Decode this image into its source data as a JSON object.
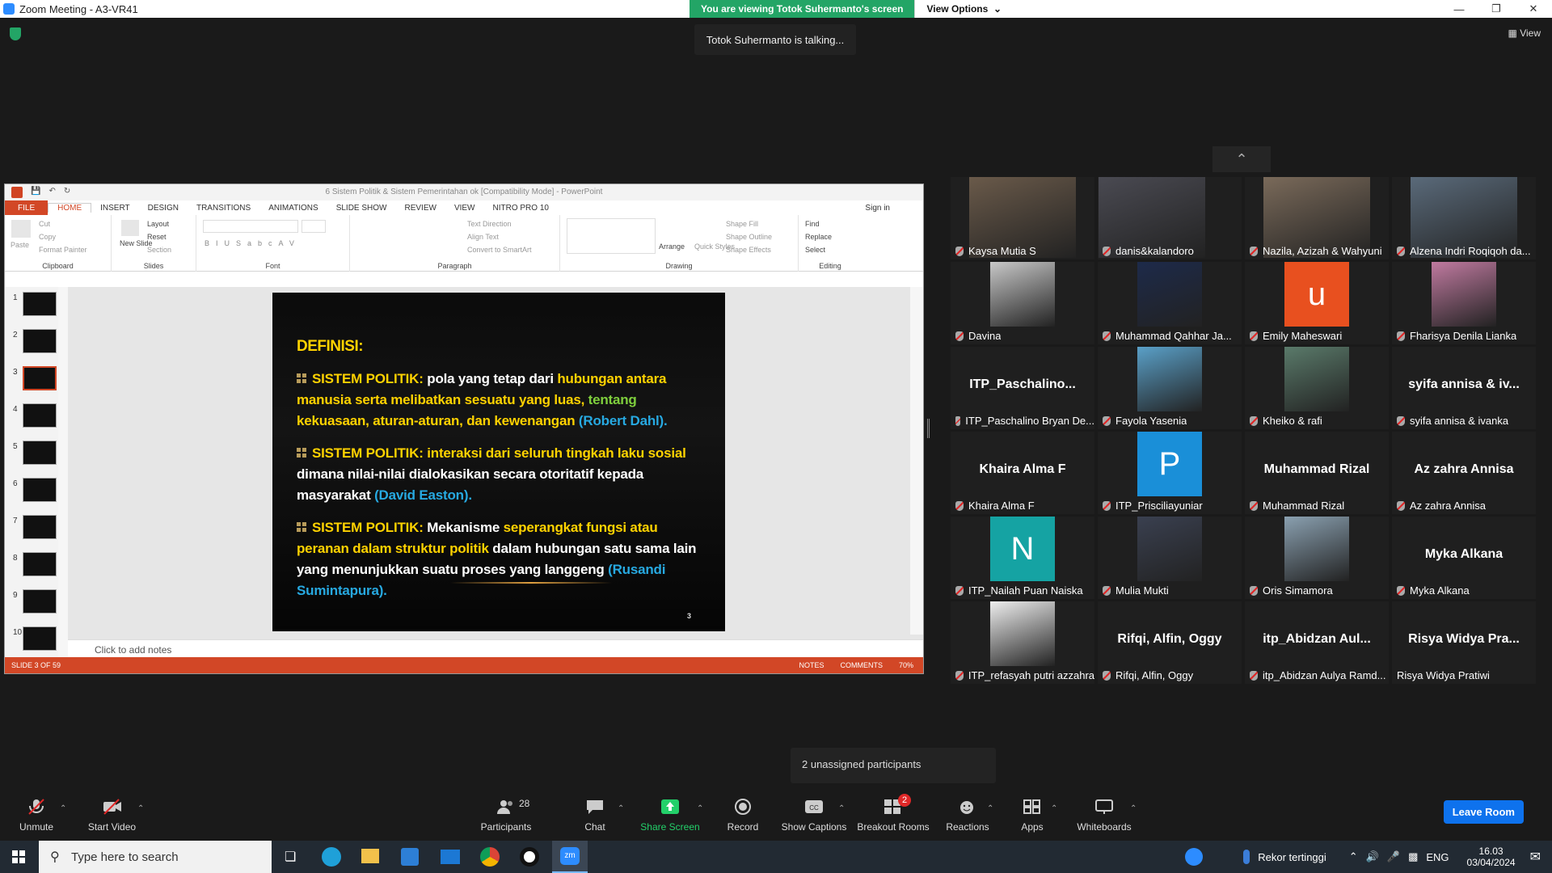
{
  "window": {
    "title": "Zoom Meeting - A3-VR41"
  },
  "banner": {
    "viewing": "You are viewing Totok Suhermanto's screen",
    "view_options": "View Options"
  },
  "talking": "Totok Suhermanto is talking...",
  "top_view_label": "View",
  "ppt": {
    "title": "6 Sistem Politik & Sistem Pemerintahan ok [Compatibility Mode] - PowerPoint",
    "tabs": [
      "FILE",
      "HOME",
      "INSERT",
      "DESIGN",
      "TRANSITIONS",
      "ANIMATIONS",
      "SLIDE SHOW",
      "REVIEW",
      "VIEW",
      "NITRO PRO 10"
    ],
    "sign_in": "Sign in",
    "ribbon": {
      "clipboard": {
        "paste": "Paste",
        "cut": "Cut",
        "copy": "Copy",
        "format_painter": "Format Painter",
        "label": "Clipboard"
      },
      "slides": {
        "new_slide": "New Slide",
        "layout": "Layout",
        "reset": "Reset",
        "section": "Section",
        "label": "Slides"
      },
      "font": {
        "label": "Font"
      },
      "paragraph": {
        "text_direction": "Text Direction",
        "align_text": "Align Text",
        "convert": "Convert to SmartArt",
        "label": "Paragraph"
      },
      "drawing": {
        "arrange": "Arrange",
        "quick_styles": "Quick Styles",
        "shape_fill": "Shape Fill",
        "shape_outline": "Shape Outline",
        "shape_effects": "Shape Effects",
        "label": "Drawing"
      },
      "editing": {
        "find": "Find",
        "replace": "Replace",
        "select": "Select",
        "label": "Editing"
      }
    },
    "thumb_numbers": [
      "1",
      "2",
      "3",
      "4",
      "5",
      "6",
      "7",
      "8",
      "9",
      "10"
    ],
    "slide": {
      "heading": "DEFINISI:",
      "p1": {
        "a": "SISTEM POLITIK:",
        "b": " pola yang tetap dari ",
        "c": "hubungan antara manusia serta melibatkan sesuatu yang luas,",
        "d": " tentang",
        "e": " kekuasaan, aturan-aturan, dan kewenangan",
        "f": " (Robert Dahl)."
      },
      "p2": {
        "a": "SISTEM POLITIK:",
        "b": " interaksi dari seluruh tingkah laku sosial",
        "c": " dimana nilai-nilai dialokasikan secara otoritatif kepada masyarakat",
        "d": " (David Easton)."
      },
      "p3": {
        "a": "SISTEM POLITIK:",
        "b": " Mekanisme ",
        "c": "seperangkat fungsi atau peranan dalam struktur politik",
        "d": " dalam hubungan satu sama lain yang menunjukkan suatu proses yang langgeng",
        "e": " (Rusandi Sumintapura)."
      },
      "page_number": "3"
    },
    "notes_placeholder": "Click to add notes",
    "status": {
      "slide": "SLIDE 3 OF 59",
      "notes": "NOTES",
      "comments": "COMMENTS",
      "zoom": "70%"
    }
  },
  "participants": [
    {
      "name": "Kaysa Mutia S",
      "kind": "video"
    },
    {
      "name": "danis&kalandoro",
      "kind": "video"
    },
    {
      "name": "Nazila, Azizah & Wahyuni",
      "kind": "video"
    },
    {
      "name": "Alzena Indri Roqiqoh da...",
      "kind": "video"
    },
    {
      "name": "Davina",
      "kind": "photo"
    },
    {
      "name": "Muhammad Qahhar Ja...",
      "kind": "photo"
    },
    {
      "name": "Emily Maheswari",
      "kind": "letter",
      "letter": "u",
      "color": "#e8501f"
    },
    {
      "name": "Fharisya Denila Lianka",
      "kind": "photo"
    },
    {
      "name": "ITP_Paschalino Bryan De...",
      "kind": "text",
      "big": "ITP_Paschalino..."
    },
    {
      "name": "Fayola Yasenia",
      "kind": "photo"
    },
    {
      "name": "Kheiko & rafi",
      "kind": "photo"
    },
    {
      "name": "syifa annisa & ivanka",
      "kind": "text",
      "big": "syifa annisa & iv..."
    },
    {
      "name": "Khaira Alma F",
      "kind": "text",
      "big": "Khaira Alma F"
    },
    {
      "name": "ITP_Prisciliayuniar",
      "kind": "letter",
      "letter": "P",
      "color": "#1a8fd8"
    },
    {
      "name": "Muhammad Rizal",
      "kind": "text",
      "big": "Muhammad Rizal"
    },
    {
      "name": "Az zahra Annisa",
      "kind": "text",
      "big": "Az zahra Annisa"
    },
    {
      "name": "ITP_Nailah Puan Naiska",
      "kind": "letter",
      "letter": "N",
      "color": "#15a3a3"
    },
    {
      "name": "Mulia Mukti",
      "kind": "photo"
    },
    {
      "name": "Oris Simamora",
      "kind": "photo"
    },
    {
      "name": "Myka Alkana",
      "kind": "text",
      "big": "Myka Alkana"
    },
    {
      "name": "ITP_refasyah putri azzahra",
      "kind": "photo"
    },
    {
      "name": "Rifqi, Alfin, Oggy",
      "kind": "text",
      "big": "Rifqi, Alfin, Oggy"
    },
    {
      "name": "itp_Abidzan Aulya Ramd...",
      "kind": "text",
      "big": "itp_Abidzan  Aul..."
    },
    {
      "name": "Risya Widya Pratiwi",
      "kind": "text",
      "big": "Risya  Widya  Pra...",
      "unmuted": true
    }
  ],
  "unassigned": "2 unassigned participants",
  "toolbar": {
    "unmute": "Unmute",
    "start_video": "Start Video",
    "participants": "Participants",
    "participants_count": "28",
    "chat": "Chat",
    "share_screen": "Share Screen",
    "record": "Record",
    "show_captions": "Show Captions",
    "breakout_rooms": "Breakout Rooms",
    "breakout_badge": "2",
    "reactions": "Reactions",
    "apps": "Apps",
    "whiteboards": "Whiteboards",
    "leave": "Leave Room"
  },
  "taskbar": {
    "search_placeholder": "Type here to search",
    "news": "Rekor tertinggi",
    "lang": "ENG",
    "time": "16.03",
    "date": "03/04/2024"
  }
}
